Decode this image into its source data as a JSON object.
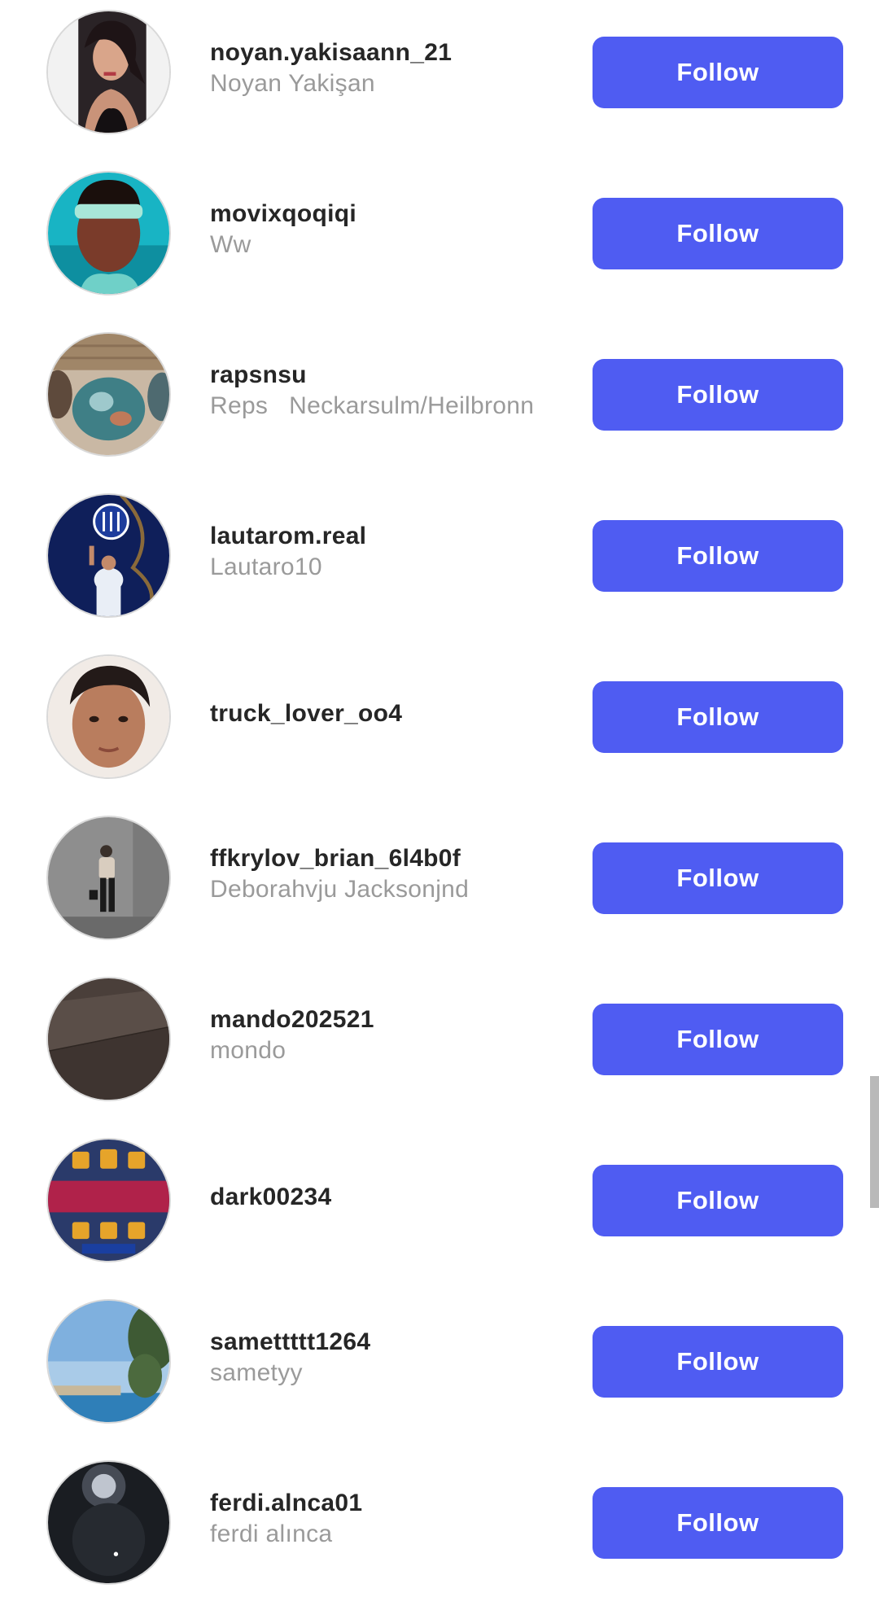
{
  "accent_color": "#4f5cf2",
  "users": [
    {
      "username": "noyan.yakisaann_21",
      "full_name": "Noyan Yakişan",
      "follow_label": "Follow",
      "avatar_icon": "woman-portrait"
    },
    {
      "username": "movixqoqiqi",
      "full_name": "Ww",
      "follow_label": "Follow",
      "avatar_icon": "man-headband"
    },
    {
      "username": "rapsnsu",
      "full_name": "Reps   Neckarsulm/Heilbronn",
      "follow_label": "Follow",
      "avatar_icon": "caps-photo"
    },
    {
      "username": "lautarom.real",
      "full_name": "Lautaro10",
      "follow_label": "Follow",
      "avatar_icon": "football-player"
    },
    {
      "username": "truck_lover_oo4",
      "full_name": "",
      "follow_label": "Follow",
      "avatar_icon": "boy-portrait"
    },
    {
      "username": "ffkrylov_brian_6l4b0f",
      "full_name": "Deborahvju Jacksonjnd",
      "follow_label": "Follow",
      "avatar_icon": "woman-standing"
    },
    {
      "username": "mando202521",
      "full_name": "mondo",
      "follow_label": "Follow",
      "avatar_icon": "dark-wall"
    },
    {
      "username": "dark00234",
      "full_name": "",
      "follow_label": "Follow",
      "avatar_icon": "game-banner"
    },
    {
      "username": "samettttt1264",
      "full_name": "sametyy",
      "follow_label": "Follow",
      "avatar_icon": "sea-tree"
    },
    {
      "username": "ferdi.alnca01",
      "full_name": "ferdi alınca",
      "follow_label": "Follow",
      "avatar_icon": "dark-lights"
    }
  ]
}
